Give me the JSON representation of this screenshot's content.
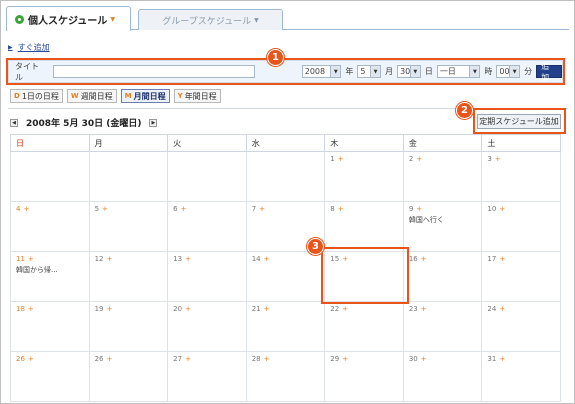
{
  "tabs": {
    "personal": "個人スケジュール",
    "group": "グループスケジュール"
  },
  "quick_add": "すぐ追加",
  "form": {
    "title_label": "タイトル",
    "year": "2008",
    "year_unit": "年",
    "month": "5",
    "month_unit": "月",
    "day": "30",
    "day_unit": "日",
    "allday": "一日",
    "hour_unit": "時",
    "minute": "00",
    "minute_unit": "分",
    "add_button": "追加"
  },
  "views": [
    {
      "key": "D",
      "label": "1日の日程"
    },
    {
      "key": "W",
      "label": "週間日程"
    },
    {
      "key": "M",
      "label": "月間日程"
    },
    {
      "key": "Y",
      "label": "年間日程"
    }
  ],
  "date_header": "2008年 5月 30日 (金曜日)",
  "regular_button": "定期スケジュール追加",
  "callouts": [
    "1",
    "2",
    "3"
  ],
  "weekdays": [
    "日",
    "月",
    "火",
    "水",
    "木",
    "金",
    "土"
  ],
  "weeks": [
    [
      {
        "d": ""
      },
      {
        "d": ""
      },
      {
        "d": ""
      },
      {
        "d": ""
      },
      {
        "d": "1",
        "p": "+"
      },
      {
        "d": "2",
        "p": "+"
      },
      {
        "d": "3",
        "p": "+"
      }
    ],
    [
      {
        "d": "4",
        "p": "+"
      },
      {
        "d": "5",
        "p": "+"
      },
      {
        "d": "6",
        "p": "+"
      },
      {
        "d": "7",
        "p": "+"
      },
      {
        "d": "8",
        "p": "+"
      },
      {
        "d": "9",
        "p": "+",
        "ev": "韓国へ行く"
      },
      {
        "d": "10",
        "p": "+"
      }
    ],
    [
      {
        "d": "11",
        "p": "+",
        "ev": "韓国から帰..."
      },
      {
        "d": "12",
        "p": "+"
      },
      {
        "d": "13",
        "p": "+"
      },
      {
        "d": "14",
        "p": "+"
      },
      {
        "d": "15",
        "p": "+"
      },
      {
        "d": "16",
        "p": "+"
      },
      {
        "d": "17",
        "p": "+"
      }
    ],
    [
      {
        "d": "18",
        "p": "+"
      },
      {
        "d": "19",
        "p": "+"
      },
      {
        "d": "20",
        "p": "+"
      },
      {
        "d": "21",
        "p": "+"
      },
      {
        "d": "22",
        "p": "+"
      },
      {
        "d": "23",
        "p": "+"
      },
      {
        "d": "24",
        "p": "+"
      }
    ],
    [
      {
        "d": "26",
        "p": "+"
      },
      {
        "d": "26",
        "p": "+"
      },
      {
        "d": "27",
        "p": "+"
      },
      {
        "d": "28",
        "p": "+"
      },
      {
        "d": "29",
        "p": "+"
      },
      {
        "d": "30",
        "p": "+"
      },
      {
        "d": "31",
        "p": "+"
      }
    ]
  ],
  "colors": {
    "highlight": "#e8541a",
    "sunday": "#d23a1a",
    "accent": "#24408a"
  }
}
